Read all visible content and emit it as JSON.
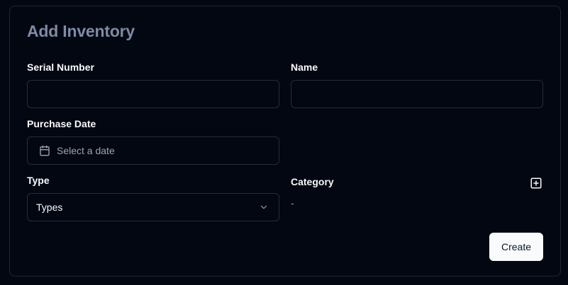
{
  "form": {
    "title": "Add Inventory",
    "serial_number": {
      "label": "Serial Number",
      "value": ""
    },
    "name": {
      "label": "Name",
      "value": ""
    },
    "purchase_date": {
      "label": "Purchase Date",
      "placeholder": "Select a date"
    },
    "type": {
      "label": "Type",
      "selected": "Types"
    },
    "category": {
      "label": "Category",
      "value": "-"
    },
    "create_label": "Create"
  },
  "icons": {
    "date": "calendar-icon",
    "select": "chevron-down-icon",
    "add_category": "plus-square-icon"
  },
  "colors": {
    "background": "#030712",
    "title": "#7e8ba3",
    "border": "#262c3a",
    "button_bg": "#f8fafc",
    "button_text": "#0f172a"
  }
}
